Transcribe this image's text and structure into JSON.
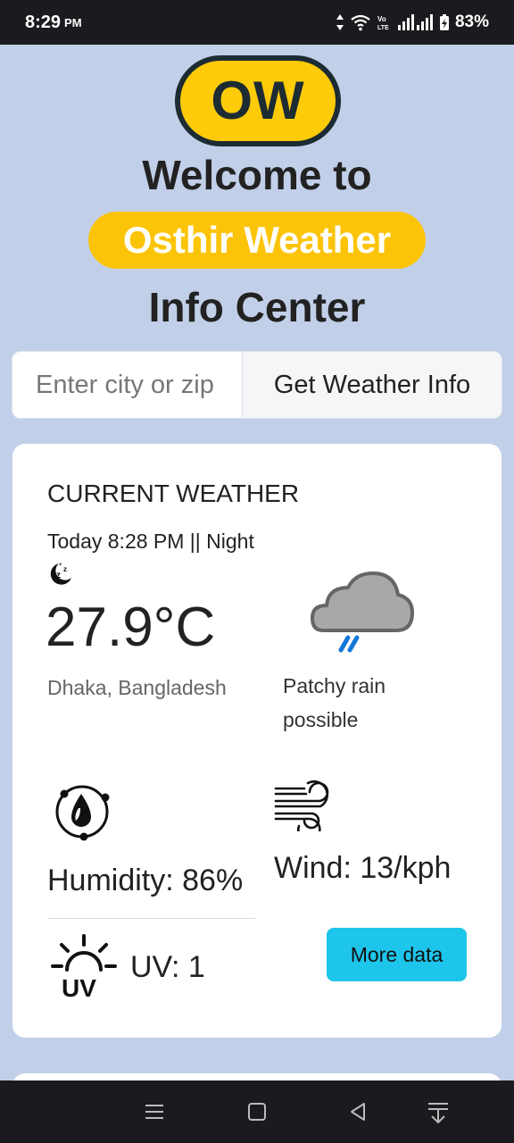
{
  "status": {
    "time": "8:29",
    "ampm": "PM",
    "battery": "83%"
  },
  "logo": {
    "text": "OW"
  },
  "header": {
    "line1": "Welcome to",
    "brand": "Osthir Weather",
    "line3": "Info Center"
  },
  "search": {
    "placeholder": "Enter city or zip",
    "button_label": "Get Weather Info"
  },
  "current": {
    "title": "CURRENT WEATHER",
    "datetime": "Today 8:28 PM || Night",
    "temperature": "27.9°C",
    "location": "Dhaka, Bangladesh",
    "condition": "Patchy rain possible",
    "humidity": "Humidity: 86%",
    "wind": "Wind: 13/kph",
    "uv": "UV: 1",
    "more_label": "More data"
  },
  "icons": {
    "weather": "night-rain-cloud-icon",
    "humidity": "humidity-icon",
    "wind": "wind-icon",
    "uv": "uv-icon"
  },
  "colors": {
    "page_bg": "#c2cfe8",
    "brand_yellow": "#fcc409",
    "logo_dark": "#1d2b33",
    "button_cyan": "#1ec5ea",
    "moon_blue": "#1277d8"
  }
}
